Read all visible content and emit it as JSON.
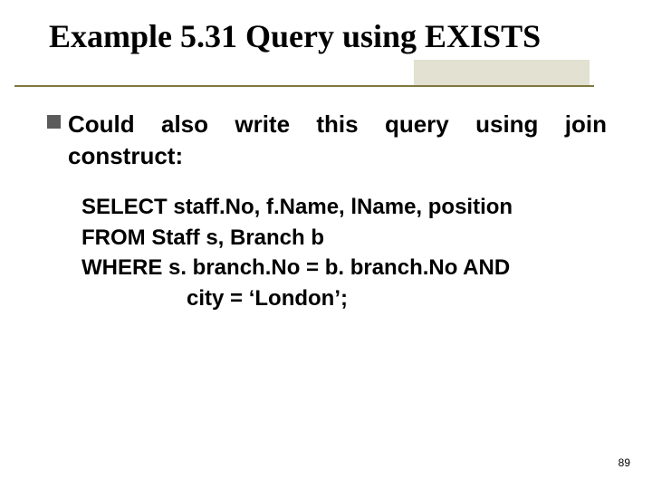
{
  "title": "Example 5.31  Query using EXISTS",
  "bullet": {
    "line1": "Could also write this query using join",
    "line2": "construct:"
  },
  "sql": {
    "l1": "SELECT staff.No, f.Name, lName, position",
    "l2": "FROM Staff s, Branch b",
    "l3": "WHERE s. branch.No = b. branch.No AND",
    "l4": "city = ‘London’;"
  },
  "pageNumber": "89"
}
